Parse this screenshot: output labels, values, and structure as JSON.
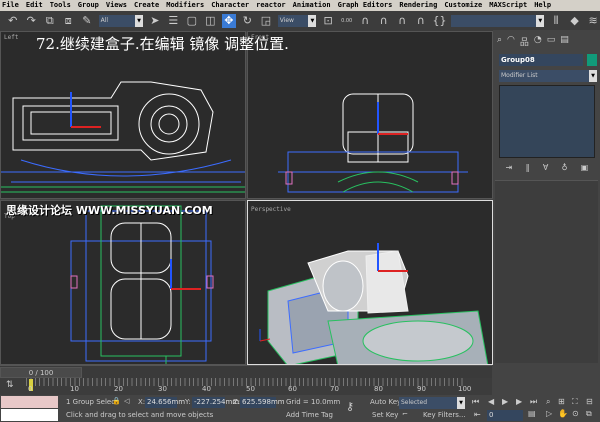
{
  "menu": [
    "File",
    "Edit",
    "Tools",
    "Group",
    "Views",
    "Create",
    "Modifiers",
    "Character",
    "reactor",
    "Animation",
    "Graph Editors",
    "Rendering",
    "Customize",
    "MAXScript",
    "Help"
  ],
  "toolbar": {
    "selection_filter": "All",
    "ref_coord": "View",
    "named_selection": "",
    "snap_value": "0.00"
  },
  "caption": "72.继续建盒子.在编辑 镜像 调整位置.",
  "watermark": "思缘设计论坛 WWW.MISSYUAN.COM",
  "viewports": {
    "top_left": "Left",
    "top_right": "Front",
    "bottom_left": "Top",
    "bottom_right": "Perspective"
  },
  "command_panel": {
    "object_name": "Group08",
    "object_color": "#109a7a",
    "modifier_list": "Modifier List"
  },
  "timeline": {
    "frame": "0 / 100",
    "ticks": [
      "0",
      "10",
      "20",
      "30",
      "40",
      "50",
      "60",
      "70",
      "80",
      "90",
      "100"
    ]
  },
  "status": {
    "selection": "1 Group Selec",
    "x_label": "X:",
    "x": "24.656mm",
    "y_label": "Y:",
    "y": "-227.254mm",
    "z_label": "Z:",
    "z": "625.598mm",
    "grid": "Grid = 10.0mm",
    "prompt": "Click and drag to select and move objects",
    "add_time_tag": "Add Time Tag",
    "auto_key": "Auto Key",
    "auto_key_mode": "Selected",
    "set_key": "Set Key",
    "key_filters": "Key Filters...",
    "current_frame": "0"
  }
}
